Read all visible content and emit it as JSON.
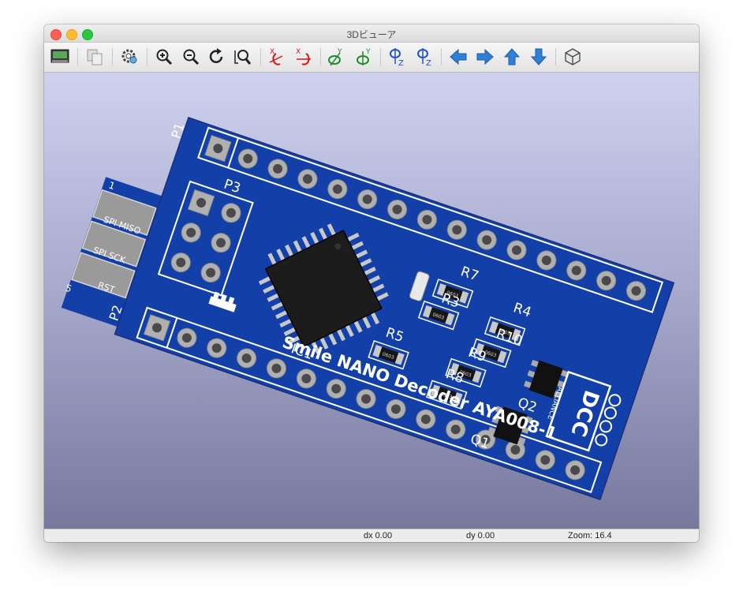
{
  "window": {
    "title": "3Dビューア"
  },
  "toolbar": {
    "buttons": [
      {
        "icon": "render-toggle-icon"
      },
      {
        "icon": "copy-icon"
      },
      {
        "icon": "settings-icon"
      },
      {
        "icon": "zoom-in-icon"
      },
      {
        "icon": "zoom-out-icon"
      },
      {
        "icon": "redraw-icon"
      },
      {
        "icon": "zoom-fit-icon"
      },
      {
        "icon": "rotate-x-cw-icon"
      },
      {
        "icon": "rotate-x-ccw-icon"
      },
      {
        "icon": "rotate-y-cw-icon"
      },
      {
        "icon": "rotate-y-ccw-icon"
      },
      {
        "icon": "rotate-z-cw-icon"
      },
      {
        "icon": "rotate-z-ccw-icon"
      },
      {
        "icon": "move-left-icon"
      },
      {
        "icon": "move-right-icon"
      },
      {
        "icon": "move-up-icon"
      },
      {
        "icon": "move-down-icon"
      },
      {
        "icon": "ortho-view-icon"
      }
    ],
    "axis_labels": {
      "x": "X",
      "y": "Y",
      "z": "Z"
    }
  },
  "board": {
    "title": "Smile NANO Decoder AYA008-1",
    "refs": {
      "p1": "P1",
      "p2": "P2",
      "p3": "P3",
      "ic1": "IC1",
      "r7": "R7",
      "r3": "R3",
      "r4": "R4",
      "r10": "R10",
      "r9": "R9",
      "r8": "R8",
      "r5": "R5",
      "q1": "Q1",
      "q2": "Q2"
    },
    "edge_labels": {
      "pin1": "1",
      "pin5": "5",
      "miso": "SPI MISO",
      "sck": "SPI SCK",
      "rst": "RST"
    },
    "package": "0603",
    "logo": {
      "text": "DCC",
      "side": "ALLIANCE"
    }
  },
  "colors": {
    "board": "#1340a8",
    "silk": "#ffffff",
    "chip": "#1c1c1c",
    "pad": "#a8a8a8"
  },
  "status": {
    "dx": "dx 0.00",
    "dy": "dy 0.00",
    "zoom": "Zoom: 16.4"
  }
}
